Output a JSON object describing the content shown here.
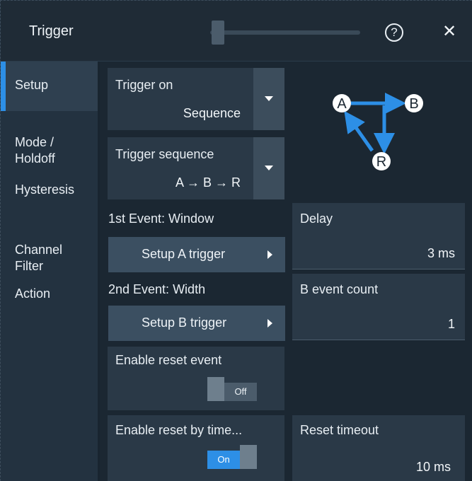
{
  "header": {
    "title": "Trigger",
    "help_symbol": "?",
    "close_symbol": "✕"
  },
  "sidebar": {
    "items": [
      {
        "label": "Setup",
        "active": true
      },
      {
        "label": "Mode /\nHoldoff",
        "active": false
      },
      {
        "label": "Hysteresis",
        "active": false
      },
      {
        "label": "Channel\nFilter",
        "active": false
      },
      {
        "label": "Action",
        "active": false
      }
    ]
  },
  "trigger_on": {
    "label": "Trigger on",
    "value": "Sequence"
  },
  "trigger_sequence": {
    "label": "Trigger sequence",
    "value": "A → B → R"
  },
  "diagram": {
    "node_a": "A",
    "node_b": "B",
    "node_r": "R",
    "arrow_color": "#2d8fe6"
  },
  "event1": {
    "label": "1st Event: Window",
    "button_label": "Setup A trigger"
  },
  "delay": {
    "label": "Delay",
    "value": "3 ms"
  },
  "event2": {
    "label": "2nd Event: Width",
    "button_label": "Setup B trigger"
  },
  "b_event_count": {
    "label": "B event count",
    "value": "1"
  },
  "reset_event": {
    "label": "Enable reset event",
    "state": "Off"
  },
  "reset_timeout_enable": {
    "label": "Enable reset by time...",
    "state": "On"
  },
  "reset_timeout": {
    "label": "Reset timeout",
    "value": "10 ms"
  },
  "colors": {
    "accent": "#2d8fe6",
    "panel": "#2a3947",
    "background": "#1b2732"
  }
}
